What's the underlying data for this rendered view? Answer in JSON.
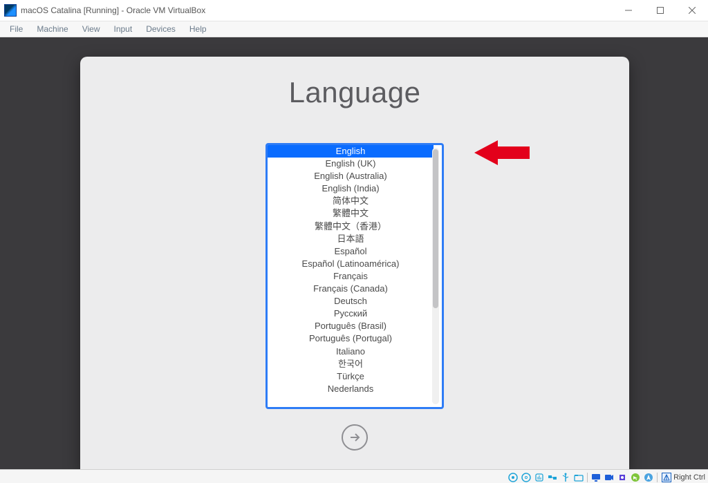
{
  "window": {
    "title": "macOS Catalina [Running] - Oracle VM VirtualBox"
  },
  "menu": [
    "File",
    "Machine",
    "View",
    "Input",
    "Devices",
    "Help"
  ],
  "macos": {
    "title": "Language",
    "languages": [
      "English",
      "English (UK)",
      "English (Australia)",
      "English (India)",
      "简体中文",
      "繁體中文",
      "繁體中文（香港）",
      "日本語",
      "Español",
      "Español (Latinoamérica)",
      "Français",
      "Français (Canada)",
      "Deutsch",
      "Русский",
      "Português (Brasil)",
      "Português (Portugal)",
      "Italiano",
      "한국어",
      "Türkçe",
      "Nederlands"
    ],
    "selected_index": 0
  },
  "statusbar": {
    "hostkey": "Right Ctrl"
  }
}
